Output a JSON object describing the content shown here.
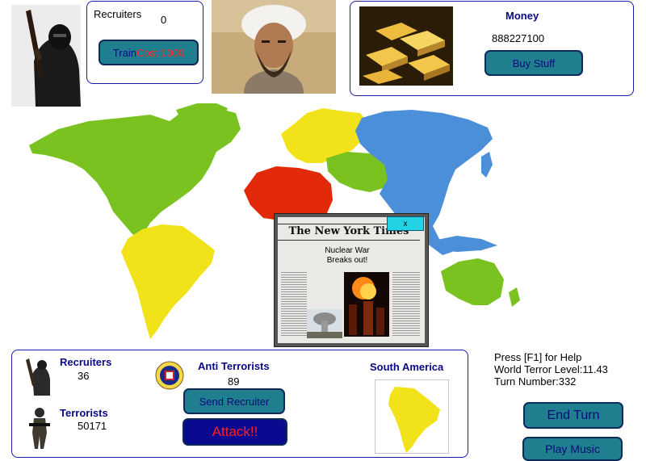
{
  "recruit_panel": {
    "label": "Recruiters",
    "value": "0",
    "train_label": "Train",
    "cost_label": "Cost 1000"
  },
  "money_panel": {
    "label": "Money",
    "value": "888227100",
    "buy_label": "Buy Stuff"
  },
  "news_popup": {
    "masthead": "The New York Times",
    "headline_line1": "Nuclear War",
    "headline_line2": "Breaks out!",
    "close_label": "x"
  },
  "region_panel": {
    "recruiters_label": "Recruiters",
    "recruiters_value": "36",
    "terrorists_label": "Terrorists",
    "terrorists_value": "50171",
    "anti_label": "Anti Terrorists",
    "anti_value": "89",
    "send_label": "Send Recruiter",
    "attack_label": "Attack!!",
    "region_name": "South America"
  },
  "status": {
    "help": "Press [F1] for Help",
    "terror_level": "World Terror Level:11.43",
    "turn": "Turn Number:332"
  },
  "buttons": {
    "end_turn": "End Turn",
    "play_music": "Play Music"
  },
  "colors": {
    "north_america": "#7ac21f",
    "south_america": "#f2e21a",
    "europe": "#f2e21a",
    "africa": "#e22a0a",
    "middle_east": "#7ac21f",
    "asia": "#4a8fd8",
    "australia": "#7ac21f",
    "button_teal": "#1f7f8f",
    "button_navy": "#0a0a90"
  }
}
